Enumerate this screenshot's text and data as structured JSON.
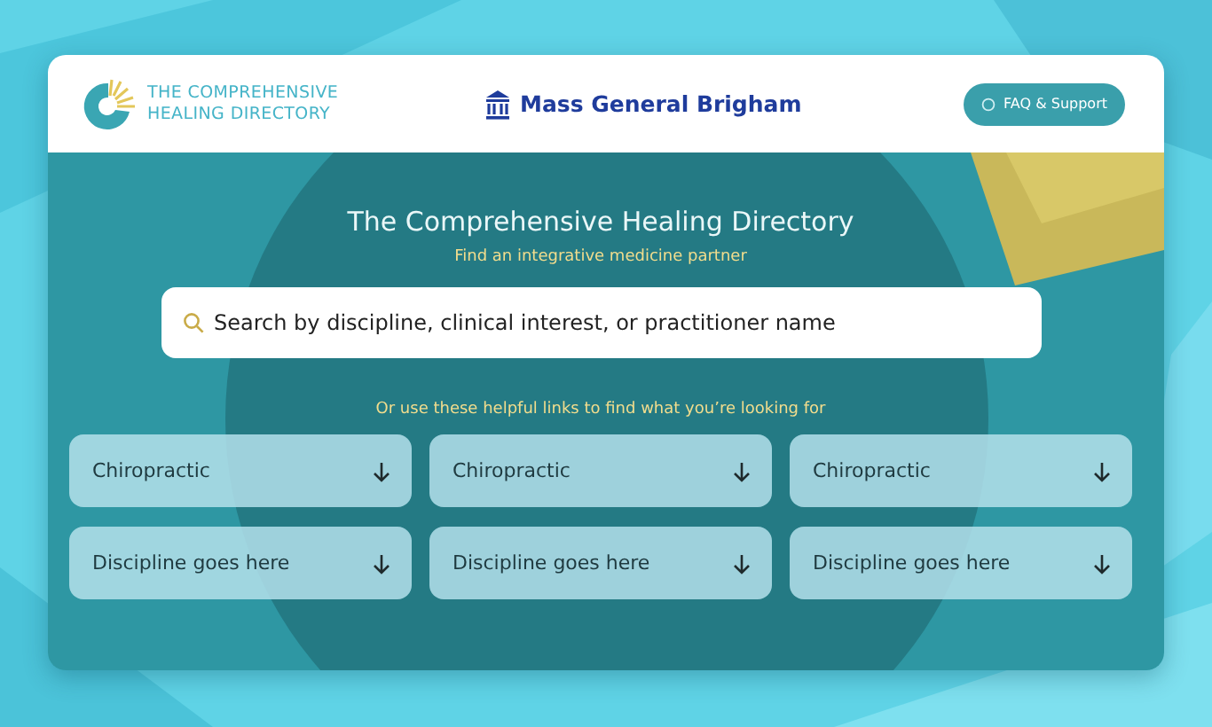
{
  "header": {
    "logo_text": "THE COMPREHENSIVE HEALING DIRECTORY",
    "partner": "Mass General Brigham",
    "support_button": "FAQ & Support"
  },
  "hero": {
    "title": "The Comprehensive Healing Directory",
    "subtitle": "Find an integrative medicine partner"
  },
  "search": {
    "placeholder": "Search by discipline, clinical interest, or practitioner name"
  },
  "helper_text": "Or use these helpful links to find what you’re looking for",
  "links": [
    {
      "label": "Chiropractic"
    },
    {
      "label": "Chiropractic"
    },
    {
      "label": "Chiropractic"
    },
    {
      "label": "Discipline goes here"
    },
    {
      "label": "Discipline goes here"
    },
    {
      "label": "Discipline goes here"
    }
  ]
}
